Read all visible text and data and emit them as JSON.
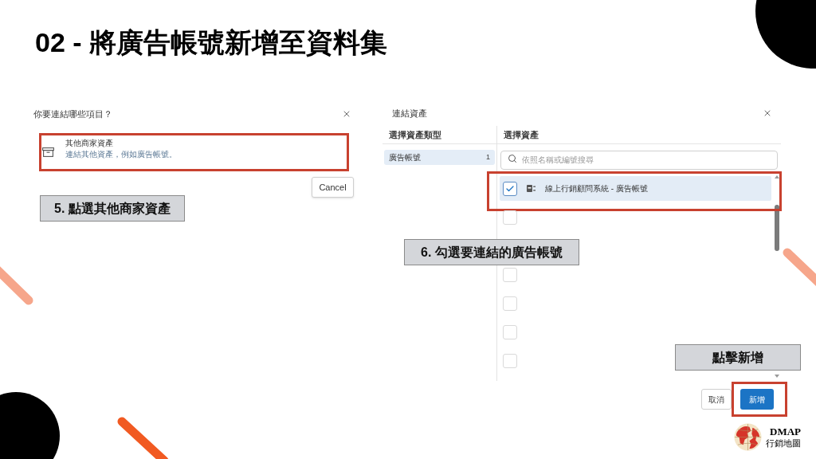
{
  "slide_title": "02 - 將廣告帳號新增至資料集",
  "connect_dialog": {
    "title": "你要連結哪些項目？",
    "options": [
      {
        "title": "其他商家資產",
        "description": "連結其他資產，例如廣告帳號。",
        "highlighted": true
      }
    ],
    "cancel_button": "Cancel"
  },
  "assets_dialog": {
    "title": "連結資產",
    "type_column": {
      "heading": "選擇資產類型",
      "items": [
        {
          "label": "廣告帳號",
          "count": "1",
          "selected": true
        }
      ]
    },
    "asset_column": {
      "heading": "選擇資產",
      "search": {
        "placeholder": "依照名稱或編號搜尋"
      },
      "rows": [
        {
          "label": "線上行銷顧問系統 - 廣告帳號",
          "checked": true,
          "highlighted": true
        },
        {
          "checked": false
        },
        {
          "checked": false
        },
        {
          "checked": false
        },
        {
          "checked": false
        },
        {
          "checked": false
        }
      ]
    },
    "buttons": [
      {
        "label": "取消",
        "kind": "secondary"
      },
      {
        "label": "新增",
        "kind": "primary",
        "highlighted": true
      }
    ]
  },
  "callouts": [
    {
      "text": "5. 點選其他商家資產"
    },
    {
      "text": "6. 勾選要連結的廣告帳號"
    },
    {
      "text": "點擊新增"
    }
  ],
  "logo": {
    "name": "DMAP",
    "tagline": "行銷地圖"
  }
}
